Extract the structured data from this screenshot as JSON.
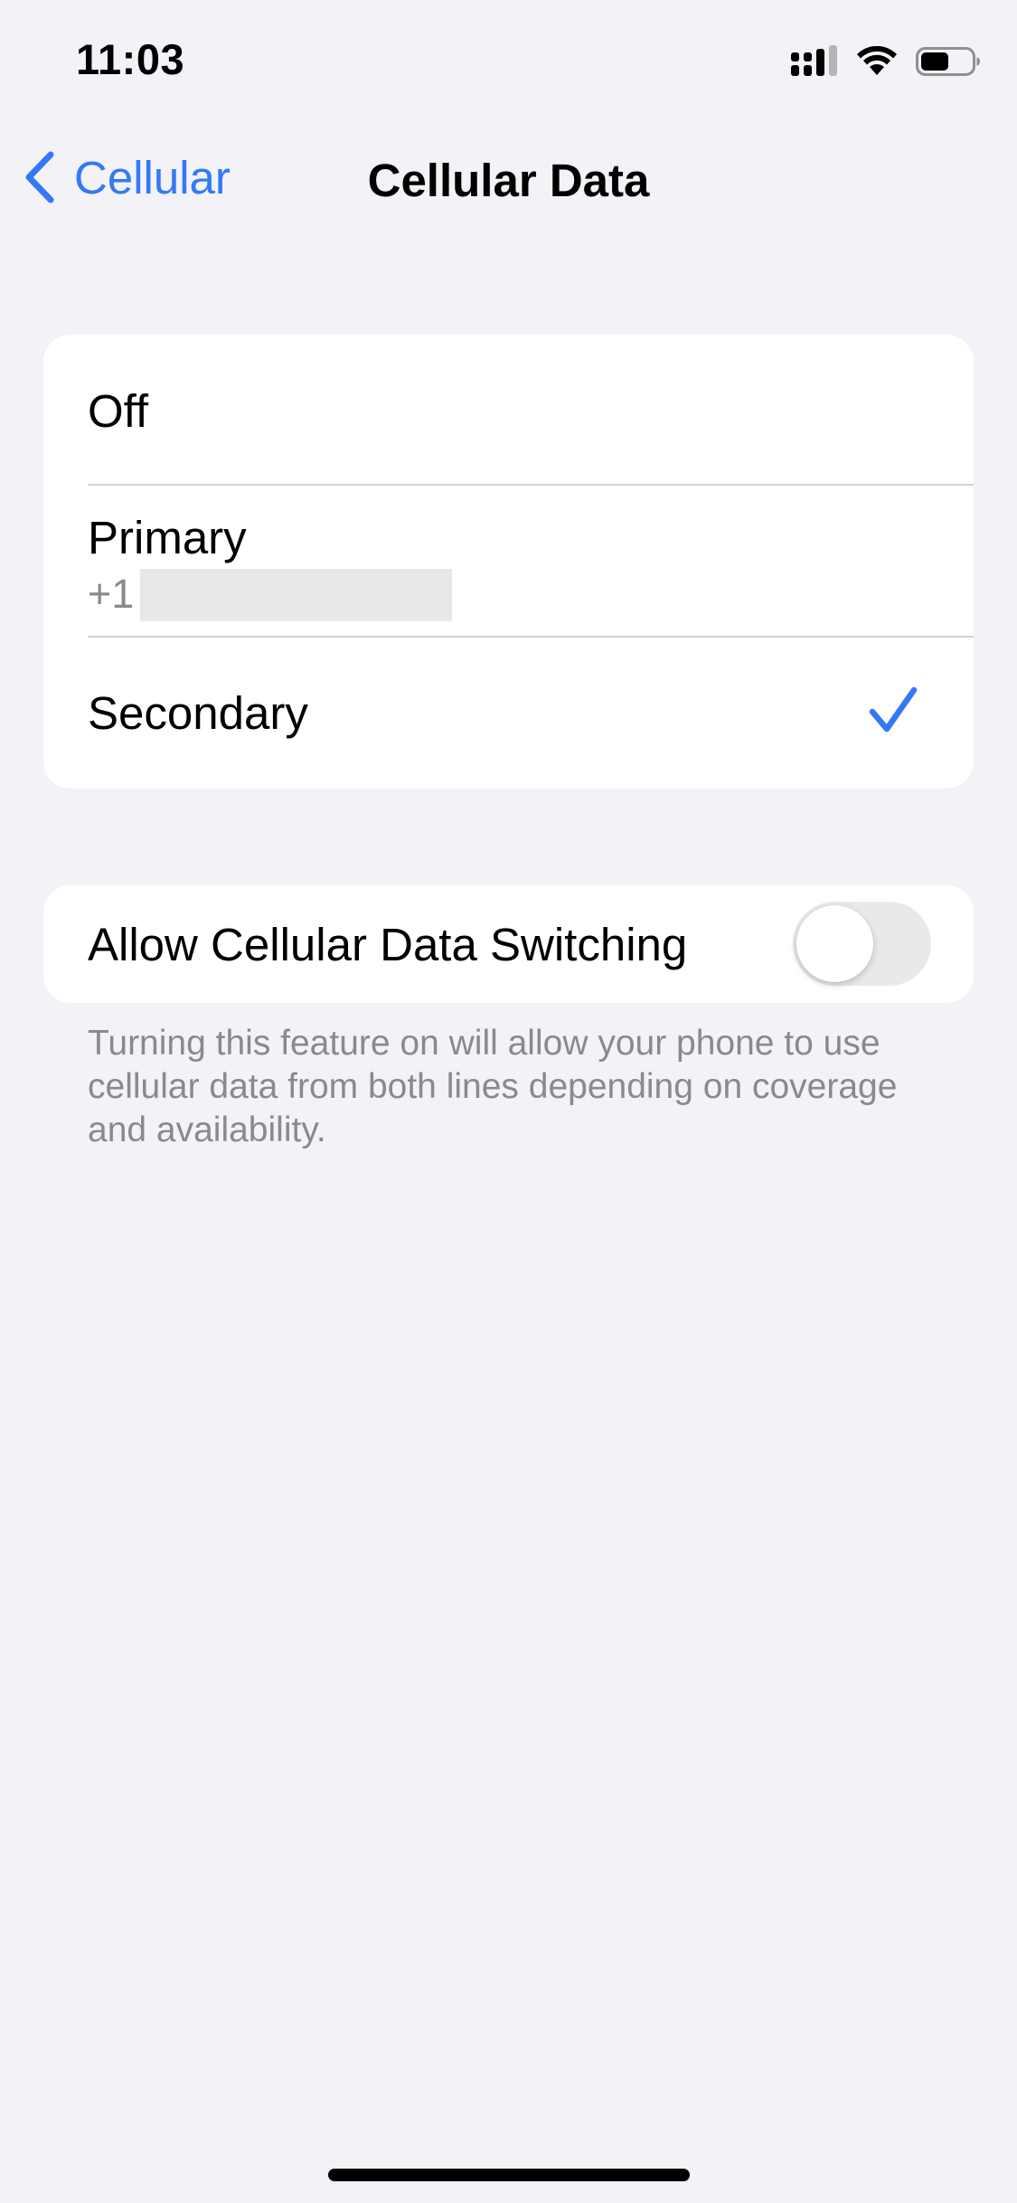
{
  "status_bar": {
    "time": "11:03",
    "icons": [
      "cellular-signal-icon",
      "wifi-icon",
      "battery-icon"
    ],
    "battery_level": 0.55
  },
  "nav": {
    "back_label": "Cellular",
    "title": "Cellular Data"
  },
  "lines": {
    "options": [
      {
        "label": "Off",
        "selected": false
      },
      {
        "label": "Primary",
        "subtitle": "+1",
        "selected": false
      },
      {
        "label": "Secondary",
        "selected": true
      }
    ]
  },
  "switching": {
    "label": "Allow Cellular Data Switching",
    "enabled": false,
    "footer": "Turning this feature on will allow your phone to use cellular data from both lines depending on coverage and availability."
  },
  "colors": {
    "accent": "#3478f6",
    "background": "#f2f2f7",
    "secondary_text": "#8a8a8e",
    "toggle_off": "#e9e9eb"
  }
}
